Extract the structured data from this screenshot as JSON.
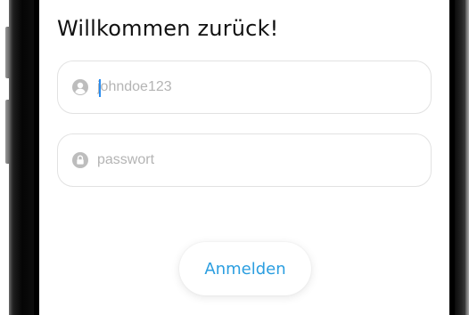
{
  "title": "Willkommen zurück!",
  "username": {
    "placeholder": "johndoe123",
    "icon": "user-icon"
  },
  "password": {
    "placeholder": "passwort",
    "icon": "lock-icon"
  },
  "login_button": {
    "label": "Anmelden"
  },
  "colors": {
    "accent": "#2b9ee0",
    "cursor": "#2a8df0",
    "icon": "#bdbdbd",
    "placeholder": "#b4b4b4",
    "border": "#e2e2e2"
  }
}
